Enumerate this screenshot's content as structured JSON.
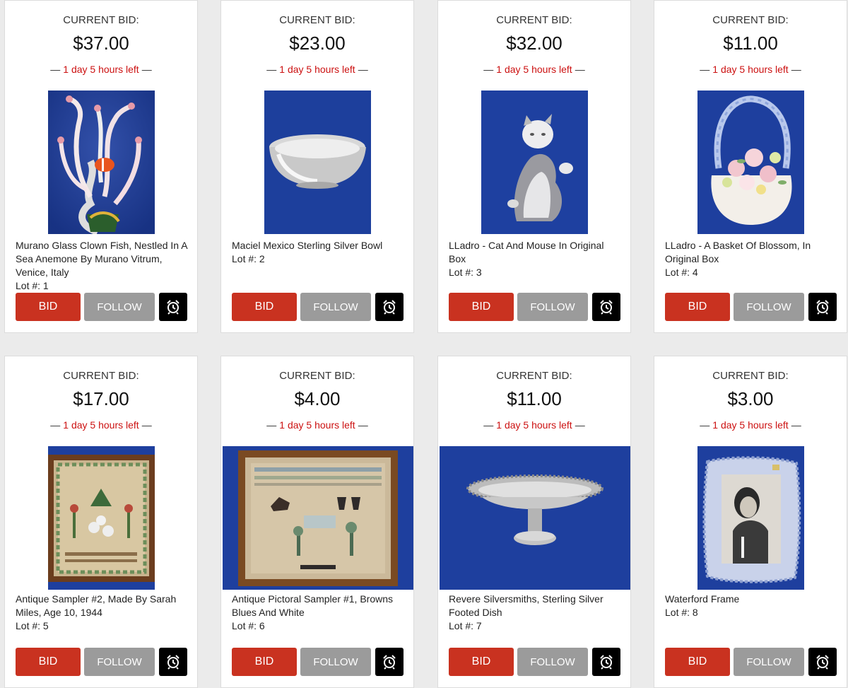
{
  "labels": {
    "current_bid": "CURRENT BID:",
    "dash": "—",
    "bid": "BID",
    "follow": "FOLLOW",
    "lot_prefix": "Lot #: "
  },
  "lots": [
    {
      "price": "$37.00",
      "time_left": "1 day 5 hours left",
      "title": "Murano Glass Clown Fish, Nestled In A Sea Anemone By Murano Vitrum, Venice, Italy",
      "lot": "1"
    },
    {
      "price": "$23.00",
      "time_left": "1 day 5 hours left",
      "title": "Maciel Mexico Sterling Silver Bowl",
      "lot": "2"
    },
    {
      "price": "$32.00",
      "time_left": "1 day 5 hours left",
      "title": "LLadro - Cat And Mouse In Original Box",
      "lot": "3"
    },
    {
      "price": "$11.00",
      "time_left": "1 day 5 hours left",
      "title": "LLadro - A Basket Of Blossom, In Original Box",
      "lot": "4"
    },
    {
      "price": "$17.00",
      "time_left": "1 day 5 hours left",
      "title": "Antique Sampler #2, Made By Sarah Miles, Age 10, 1944",
      "lot": "5"
    },
    {
      "price": "$4.00",
      "time_left": "1 day 5 hours left",
      "title": "Antique Pictoral Sampler #1, Browns Blues And White",
      "lot": "6"
    },
    {
      "price": "$11.00",
      "time_left": "1 day 5 hours left",
      "title": "Revere Silversmiths, Sterling Silver Footed Dish",
      "lot": "7"
    },
    {
      "price": "$3.00",
      "time_left": "1 day 5 hours left",
      "title": "Waterford Frame",
      "lot": "8"
    }
  ],
  "colors": {
    "bid_button": "#c93220",
    "follow_button": "#9b9b9b",
    "time_left": "#cc1111",
    "photo_backdrop": "#1f3f9e"
  },
  "icons": {
    "alarm": "alarm-clock-icon"
  }
}
